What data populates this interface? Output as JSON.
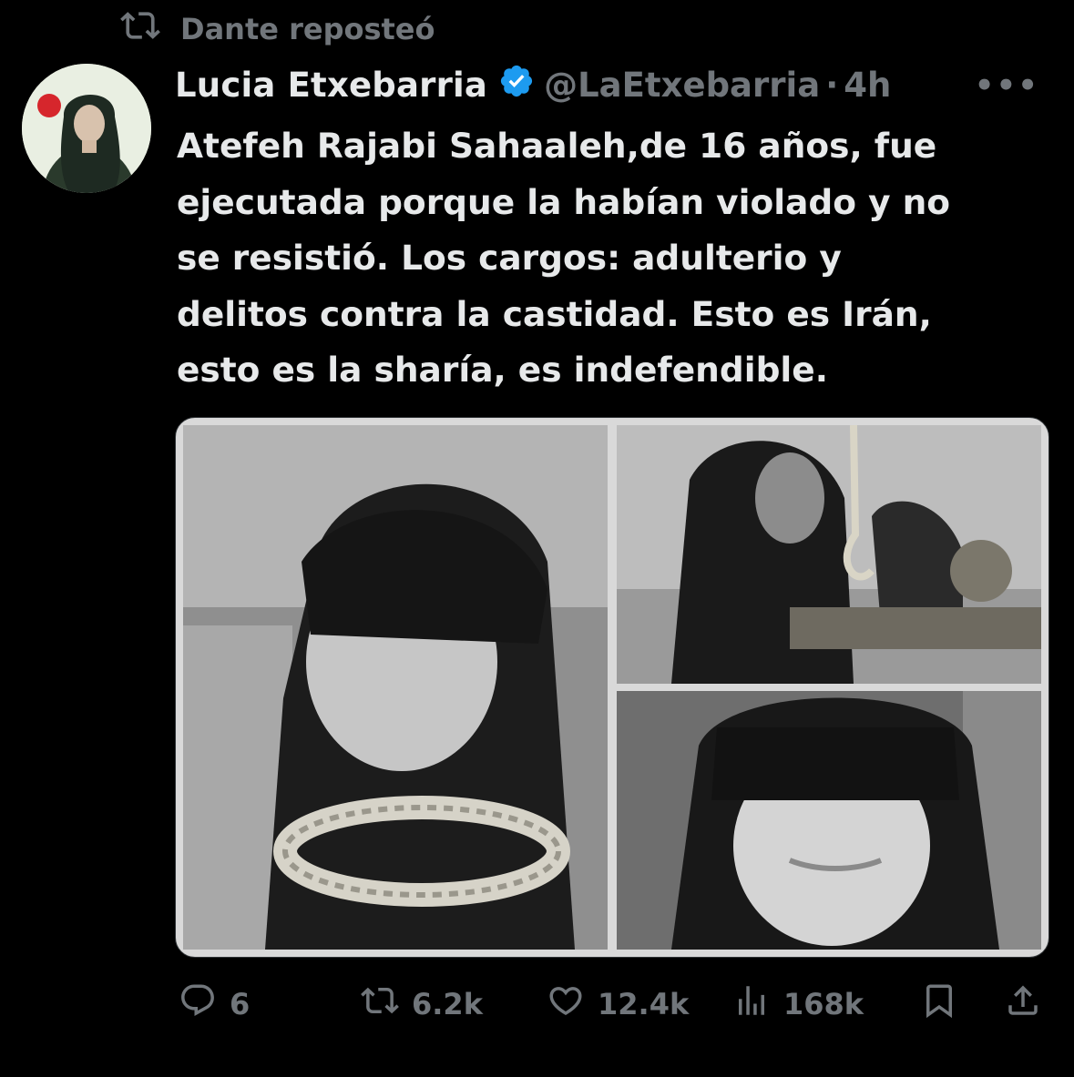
{
  "repost": {
    "label": "Dante reposteó",
    "icon": "repost-icon"
  },
  "author": {
    "name": "Lucia Etxebarria",
    "verified_icon": "verified-badge-icon",
    "handle": "@LaEtxebarria",
    "separator": "·",
    "time": "4h",
    "avatar_badge": "#T"
  },
  "more_icon": "more-options-icon",
  "tweet": {
    "text": "Atefeh Rajabi Sahaaleh,de 16 años, fue\nejecutada porque la habían violado y no\nse resistió. Los cargos:  adulterio y\ndelitos contra la castidad.  Esto es Irán,\nesto es la sharía, es indefendible."
  },
  "media": {
    "photos": [
      "photo-blindfolded-noose",
      "photo-gallows",
      "photo-blindfolded-face"
    ]
  },
  "actions": {
    "replies": "6",
    "reposts": "6.2k",
    "likes": "12.4k",
    "views": "168k"
  },
  "colors": {
    "background": "#000000",
    "text": "#e7e9ea",
    "muted": "#71767b",
    "verified": "#1d9bf0"
  }
}
